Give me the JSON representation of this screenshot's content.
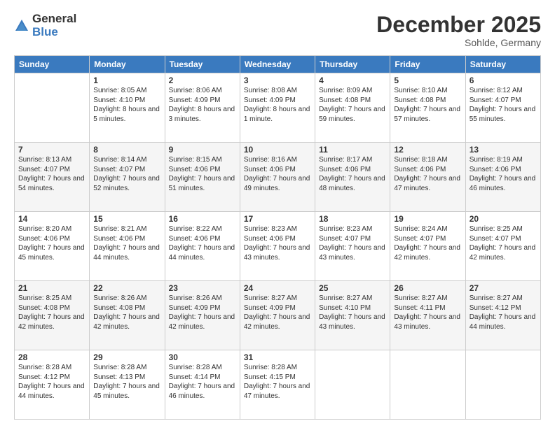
{
  "logo": {
    "general": "General",
    "blue": "Blue"
  },
  "header": {
    "month": "December 2025",
    "location": "Sohlde, Germany"
  },
  "weekdays": [
    "Sunday",
    "Monday",
    "Tuesday",
    "Wednesday",
    "Thursday",
    "Friday",
    "Saturday"
  ],
  "weeks": [
    [
      {
        "day": "",
        "info": ""
      },
      {
        "day": "1",
        "info": "Sunrise: 8:05 AM\nSunset: 4:10 PM\nDaylight: 8 hours\nand 5 minutes."
      },
      {
        "day": "2",
        "info": "Sunrise: 8:06 AM\nSunset: 4:09 PM\nDaylight: 8 hours\nand 3 minutes."
      },
      {
        "day": "3",
        "info": "Sunrise: 8:08 AM\nSunset: 4:09 PM\nDaylight: 8 hours\nand 1 minute."
      },
      {
        "day": "4",
        "info": "Sunrise: 8:09 AM\nSunset: 4:08 PM\nDaylight: 7 hours\nand 59 minutes."
      },
      {
        "day": "5",
        "info": "Sunrise: 8:10 AM\nSunset: 4:08 PM\nDaylight: 7 hours\nand 57 minutes."
      },
      {
        "day": "6",
        "info": "Sunrise: 8:12 AM\nSunset: 4:07 PM\nDaylight: 7 hours\nand 55 minutes."
      }
    ],
    [
      {
        "day": "7",
        "info": "Sunrise: 8:13 AM\nSunset: 4:07 PM\nDaylight: 7 hours\nand 54 minutes."
      },
      {
        "day": "8",
        "info": "Sunrise: 8:14 AM\nSunset: 4:07 PM\nDaylight: 7 hours\nand 52 minutes."
      },
      {
        "day": "9",
        "info": "Sunrise: 8:15 AM\nSunset: 4:06 PM\nDaylight: 7 hours\nand 51 minutes."
      },
      {
        "day": "10",
        "info": "Sunrise: 8:16 AM\nSunset: 4:06 PM\nDaylight: 7 hours\nand 49 minutes."
      },
      {
        "day": "11",
        "info": "Sunrise: 8:17 AM\nSunset: 4:06 PM\nDaylight: 7 hours\nand 48 minutes."
      },
      {
        "day": "12",
        "info": "Sunrise: 8:18 AM\nSunset: 4:06 PM\nDaylight: 7 hours\nand 47 minutes."
      },
      {
        "day": "13",
        "info": "Sunrise: 8:19 AM\nSunset: 4:06 PM\nDaylight: 7 hours\nand 46 minutes."
      }
    ],
    [
      {
        "day": "14",
        "info": "Sunrise: 8:20 AM\nSunset: 4:06 PM\nDaylight: 7 hours\nand 45 minutes."
      },
      {
        "day": "15",
        "info": "Sunrise: 8:21 AM\nSunset: 4:06 PM\nDaylight: 7 hours\nand 44 minutes."
      },
      {
        "day": "16",
        "info": "Sunrise: 8:22 AM\nSunset: 4:06 PM\nDaylight: 7 hours\nand 44 minutes."
      },
      {
        "day": "17",
        "info": "Sunrise: 8:23 AM\nSunset: 4:06 PM\nDaylight: 7 hours\nand 43 minutes."
      },
      {
        "day": "18",
        "info": "Sunrise: 8:23 AM\nSunset: 4:07 PM\nDaylight: 7 hours\nand 43 minutes."
      },
      {
        "day": "19",
        "info": "Sunrise: 8:24 AM\nSunset: 4:07 PM\nDaylight: 7 hours\nand 42 minutes."
      },
      {
        "day": "20",
        "info": "Sunrise: 8:25 AM\nSunset: 4:07 PM\nDaylight: 7 hours\nand 42 minutes."
      }
    ],
    [
      {
        "day": "21",
        "info": "Sunrise: 8:25 AM\nSunset: 4:08 PM\nDaylight: 7 hours\nand 42 minutes."
      },
      {
        "day": "22",
        "info": "Sunrise: 8:26 AM\nSunset: 4:08 PM\nDaylight: 7 hours\nand 42 minutes."
      },
      {
        "day": "23",
        "info": "Sunrise: 8:26 AM\nSunset: 4:09 PM\nDaylight: 7 hours\nand 42 minutes."
      },
      {
        "day": "24",
        "info": "Sunrise: 8:27 AM\nSunset: 4:09 PM\nDaylight: 7 hours\nand 42 minutes."
      },
      {
        "day": "25",
        "info": "Sunrise: 8:27 AM\nSunset: 4:10 PM\nDaylight: 7 hours\nand 43 minutes."
      },
      {
        "day": "26",
        "info": "Sunrise: 8:27 AM\nSunset: 4:11 PM\nDaylight: 7 hours\nand 43 minutes."
      },
      {
        "day": "27",
        "info": "Sunrise: 8:27 AM\nSunset: 4:12 PM\nDaylight: 7 hours\nand 44 minutes."
      }
    ],
    [
      {
        "day": "28",
        "info": "Sunrise: 8:28 AM\nSunset: 4:12 PM\nDaylight: 7 hours\nand 44 minutes."
      },
      {
        "day": "29",
        "info": "Sunrise: 8:28 AM\nSunset: 4:13 PM\nDaylight: 7 hours\nand 45 minutes."
      },
      {
        "day": "30",
        "info": "Sunrise: 8:28 AM\nSunset: 4:14 PM\nDaylight: 7 hours\nand 46 minutes."
      },
      {
        "day": "31",
        "info": "Sunrise: 8:28 AM\nSunset: 4:15 PM\nDaylight: 7 hours\nand 47 minutes."
      },
      {
        "day": "",
        "info": ""
      },
      {
        "day": "",
        "info": ""
      },
      {
        "day": "",
        "info": ""
      }
    ]
  ]
}
